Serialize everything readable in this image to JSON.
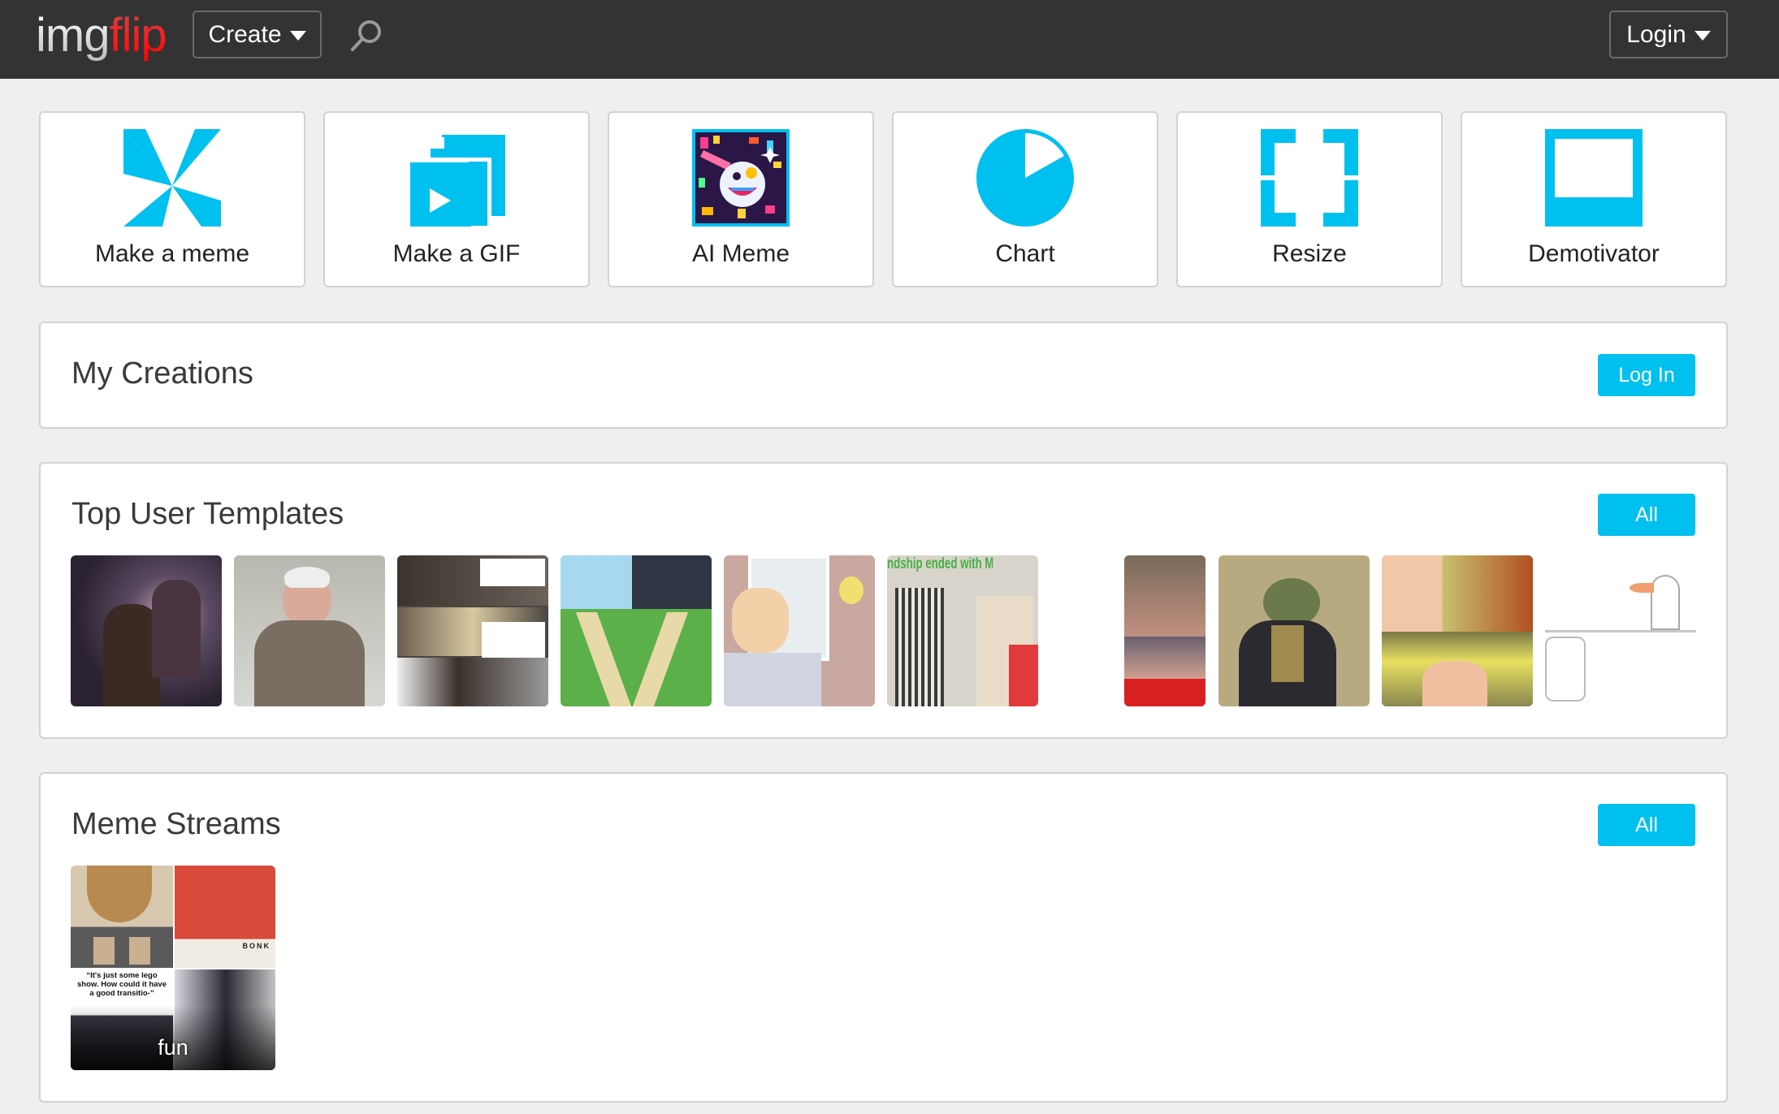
{
  "navbar": {
    "logo_part1": "img",
    "logo_part2": "flip",
    "create_label": "Create",
    "login_label": "Login",
    "search_icon": "search-icon"
  },
  "tools": [
    {
      "label": "Make a meme",
      "icon": "pinwheel-icon"
    },
    {
      "label": "Make a GIF",
      "icon": "gif-stack-icon"
    },
    {
      "label": "AI Meme",
      "icon": "ai-meme-image"
    },
    {
      "label": "Chart",
      "icon": "pie-chart-icon"
    },
    {
      "label": "Resize",
      "icon": "resize-corners-icon"
    },
    {
      "label": "Demotivator",
      "icon": "demotivator-frame-icon"
    }
  ],
  "my_creations": {
    "title": "My Creations",
    "button_label": "Log In"
  },
  "top_templates": {
    "title": "Top User Templates",
    "button_label": "All",
    "thumbnails": [
      {
        "name": "wrestlers-smoke-template"
      },
      {
        "name": "bernie-mittens-template"
      },
      {
        "name": "the-rock-driving-template"
      },
      {
        "name": "two-paths-castle-template"
      },
      {
        "name": "is-this-a-pigeon-template"
      },
      {
        "name": "friendship-ended-template",
        "caption": "ndship ended with MUDAS"
      },
      {
        "name": "vince-mcmahon-reaction-template"
      },
      {
        "name": "sophisticated-frog-template"
      },
      {
        "name": "fairly-odd-parents-template"
      },
      {
        "name": "goose-chase-template"
      }
    ]
  },
  "meme_streams": {
    "title": "Meme Streams",
    "button_label": "All",
    "streams": [
      {
        "label": "fun",
        "quote": "“It's just some lego show. How could it have a good transitio-”",
        "overlay_text": "BONK"
      }
    ]
  },
  "colors": {
    "accent": "#00c0f0",
    "navbar": "#333333",
    "logo_red": "#ff0000",
    "background": "#efefef"
  }
}
